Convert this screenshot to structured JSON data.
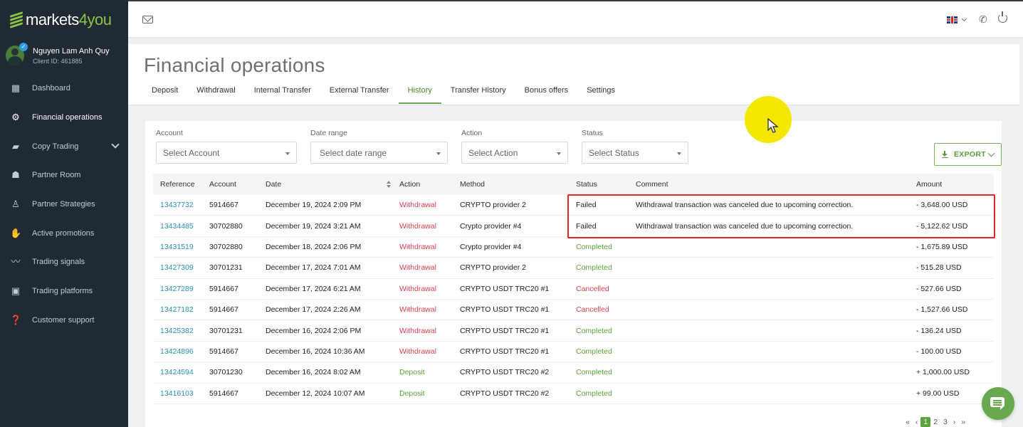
{
  "brand": {
    "logo_main": "markets",
    "logo_accent": "4you"
  },
  "user": {
    "name": "Nguyen Lam Anh Quy",
    "client_id": "Client ID: 461885"
  },
  "sidebar": {
    "items": [
      {
        "label": "Dashboard",
        "icon": "dashboard-icon"
      },
      {
        "label": "Financial operations",
        "icon": "gear-icon"
      },
      {
        "label": "Copy Trading",
        "icon": "briefcase-icon"
      },
      {
        "label": "Partner Room",
        "icon": "users-icon"
      },
      {
        "label": "Partner Strategies",
        "icon": "hierarchy-icon"
      },
      {
        "label": "Active promotions",
        "icon": "megaphone-icon"
      },
      {
        "label": "Trading signals",
        "icon": "chart-line-icon"
      },
      {
        "label": "Trading platforms",
        "icon": "platform-icon"
      },
      {
        "label": "Customer support",
        "icon": "help-icon"
      }
    ]
  },
  "page": {
    "title": "Financial operations",
    "tabs": [
      "Deposit",
      "Withdrawal",
      "Internal Transfer",
      "External Transfer",
      "History",
      "Transfer History",
      "Bonus offers",
      "Settings"
    ]
  },
  "filters": {
    "account": {
      "label": "Account",
      "placeholder": "Select Account"
    },
    "date_range": {
      "label": "Date range",
      "placeholder": "Select date range"
    },
    "action": {
      "label": "Action",
      "placeholder": "Select Action"
    },
    "status": {
      "label": "Status",
      "placeholder": "Select Status"
    },
    "export_label": "EXPORT"
  },
  "table": {
    "headers": [
      "Reference",
      "Account",
      "Date",
      "Action",
      "Method",
      "Status",
      "Comment",
      "Amount"
    ],
    "rows": [
      {
        "reference": "13437732",
        "account": "5914667",
        "date": "December 19, 2024 2:09 PM",
        "action": "Withdrawal",
        "method": "CRYPTO provider 2",
        "status": "Failed",
        "comment": "Withdrawal transaction was canceled due to upcoming correction.",
        "amount": "- 3,648.00 USD"
      },
      {
        "reference": "13434485",
        "account": "30702880",
        "date": "December 19, 2024 3:21 AM",
        "action": "Withdrawal",
        "method": "Crypto provider #4",
        "status": "Failed",
        "comment": "Withdrawal transaction was canceled due to upcoming correction.",
        "amount": "- 5,122.62 USD"
      },
      {
        "reference": "13431519",
        "account": "30702880",
        "date": "December 18, 2024 2:06 PM",
        "action": "Withdrawal",
        "method": "Crypto provider #4",
        "status": "Completed",
        "comment": "",
        "amount": "- 1,675.89 USD"
      },
      {
        "reference": "13427309",
        "account": "30701231",
        "date": "December 17, 2024 7:01 AM",
        "action": "Withdrawal",
        "method": "CRYPTO provider 2",
        "status": "Completed",
        "comment": "",
        "amount": "- 515.28 USD"
      },
      {
        "reference": "13427289",
        "account": "5914667",
        "date": "December 17, 2024 6:21 AM",
        "action": "Withdrawal",
        "method": "CRYPTO USDT TRC20 #1",
        "status": "Cancelled",
        "comment": "",
        "amount": "- 527.66 USD"
      },
      {
        "reference": "13427182",
        "account": "5914667",
        "date": "December 17, 2024 2:26 AM",
        "action": "Withdrawal",
        "method": "CRYPTO USDT TRC20 #1",
        "status": "Cancelled",
        "comment": "",
        "amount": "- 1,527.66 USD"
      },
      {
        "reference": "13425382",
        "account": "30701231",
        "date": "December 16, 2024 2:06 PM",
        "action": "Withdrawal",
        "method": "CRYPTO USDT TRC20 #1",
        "status": "Completed",
        "comment": "",
        "amount": "- 136.24 USD"
      },
      {
        "reference": "13424896",
        "account": "5914667",
        "date": "December 16, 2024 10:36 AM",
        "action": "Withdrawal",
        "method": "CRYPTO USDT TRC20 #1",
        "status": "Completed",
        "comment": "",
        "amount": "- 100.00 USD"
      },
      {
        "reference": "13424594",
        "account": "30701230",
        "date": "December 16, 2024 8:02 AM",
        "action": "Deposit",
        "method": "CRYPTO USDT TRC20 #2",
        "status": "Completed",
        "comment": "",
        "amount": "+ 1,000.00 USD"
      },
      {
        "reference": "13416103",
        "account": "5914667",
        "date": "December 12, 2024 10:07 AM",
        "action": "Deposit",
        "method": "CRYPTO USDT TRC20 #2",
        "status": "Completed",
        "comment": "",
        "amount": "+ 99.00 USD"
      }
    ]
  },
  "pagination": {
    "first": "«",
    "prev": "‹",
    "pages": [
      "1",
      "2",
      "3"
    ],
    "next": "›",
    "last": "»"
  },
  "colors": {
    "sidebar_bg": "#1f2a33",
    "accent_green": "#5ba33a",
    "link_blue": "#2a8fb8",
    "danger_red": "#d9414f",
    "highlight_red": "#e0262e",
    "cursor_halo": "#f5e800"
  }
}
